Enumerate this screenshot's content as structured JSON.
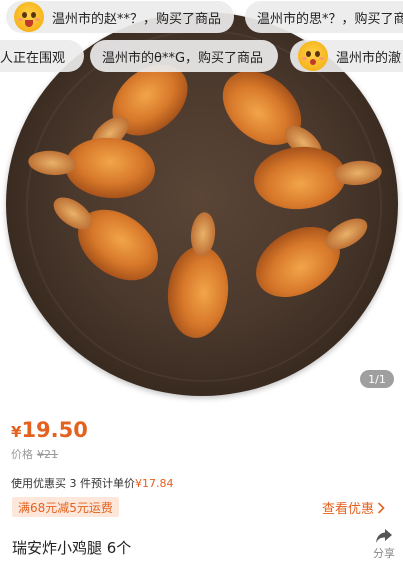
{
  "banners": [
    {
      "text": "温州市的赵**？，购买了商品"
    },
    {
      "text": "温州市的思*？，购买了商品"
    },
    {
      "text": "人正在围观"
    },
    {
      "text": "温州市的θ**G，购买了商品"
    },
    {
      "text": "温州市的澈"
    }
  ],
  "gallery": {
    "indicator": "1/1"
  },
  "price": {
    "symbol": "¥",
    "value": "19.50"
  },
  "original_price": {
    "label": "价格",
    "value": "¥21"
  },
  "discount_line": {
    "text": "使用优惠买 3 件预计单价",
    "unit_price": "¥17.84"
  },
  "coupon": {
    "tag": "满68元减5元运费",
    "link": "查看优惠"
  },
  "product": {
    "title": "瑞安炸小鸡腿 6个"
  },
  "share": {
    "label": "分享"
  },
  "colors": {
    "accent": "#e4621f",
    "coupon_bg": "#fde7da"
  }
}
